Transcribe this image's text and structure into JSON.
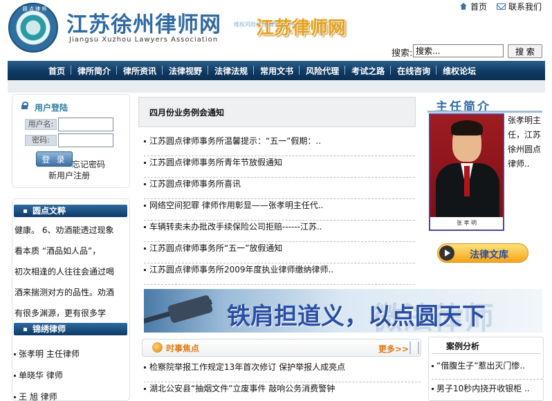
{
  "header": {
    "site_name_cn": "江苏徐州律师网",
    "site_name_en": "Jiangsu Xuzhou Lawyers Association",
    "logo_ring_text": "圆 点 律 师",
    "banner_title": "江苏律师网",
    "banner_watermark": "维权风险代理   律师咨询在线",
    "top_links": [
      {
        "label": "首页",
        "icon": "home-icon"
      },
      {
        "label": "联系我们",
        "icon": "mail-icon"
      }
    ],
    "search": {
      "label": "搜索:",
      "value": "搜索...",
      "button": "搜 索"
    }
  },
  "nav": {
    "items": [
      "首页",
      "律所简介",
      "律所资讯",
      "法律视野",
      "法律法规",
      "常用文书",
      "风险代理",
      "考试之路",
      "在线咨询",
      "维权论坛"
    ]
  },
  "login": {
    "title": "用户登陆",
    "username_label": "用户名:",
    "password_label": "密码:",
    "submit": "登 录",
    "forgot": "忘记密码",
    "register": "新用户注册"
  },
  "article": {
    "title": "圆点文粹",
    "lines": [
      "健康。 6、劝酒能透过现象",
      "看本质 “酒品如人品”，",
      "初次相逢的人往往会通过喝",
      "酒来揣测对方的品性。劝酒",
      "有很多渊源，更有很多学"
    ]
  },
  "lawyers": {
    "title": "锦绣律师",
    "items": [
      "张孝明 主任律师",
      "单晓华 律师",
      "王 旭 律师"
    ]
  },
  "notices": {
    "title": "四月份业务例会通知",
    "items": [
      "江苏圆点律师事务所温馨提示：“五一”假期：..",
      "江苏圆点律师事务所青年节放假通知",
      "江苏圆点律师事务所喜讯",
      "网络空间犯罪 律师作用彰显——张孝明主任代..",
      "车辆转卖未办批改手续保险公司拒赔------江苏..",
      "江苏圆点律师事务所“五一”放假通知",
      "江苏圆点律师事务所2009年度执业律师缴纳律师.."
    ]
  },
  "slogan": {
    "text": "铁肩担道义，以点圆天下",
    "watermark": "微法律师"
  },
  "current_affairs": {
    "title": "时事焦点",
    "more": "更多>>",
    "items": [
      "检察院举报工作规定13年首次修订 保护举报人成亮点",
      "湖北公安县“抽烟文件”立废事件 敲响公务消费警钟"
    ]
  },
  "director": {
    "heading": "主任简介",
    "bio": "张孝明主任，江苏徐州圆点律师..",
    "photo_caption": "张 孝 明"
  },
  "library": {
    "label": "法律文库"
  },
  "cases": {
    "title": "案例分析",
    "items": [
      "“借腹生子”惹出灭门惨..",
      "男子10秒内挠开收银柜 .."
    ]
  }
}
